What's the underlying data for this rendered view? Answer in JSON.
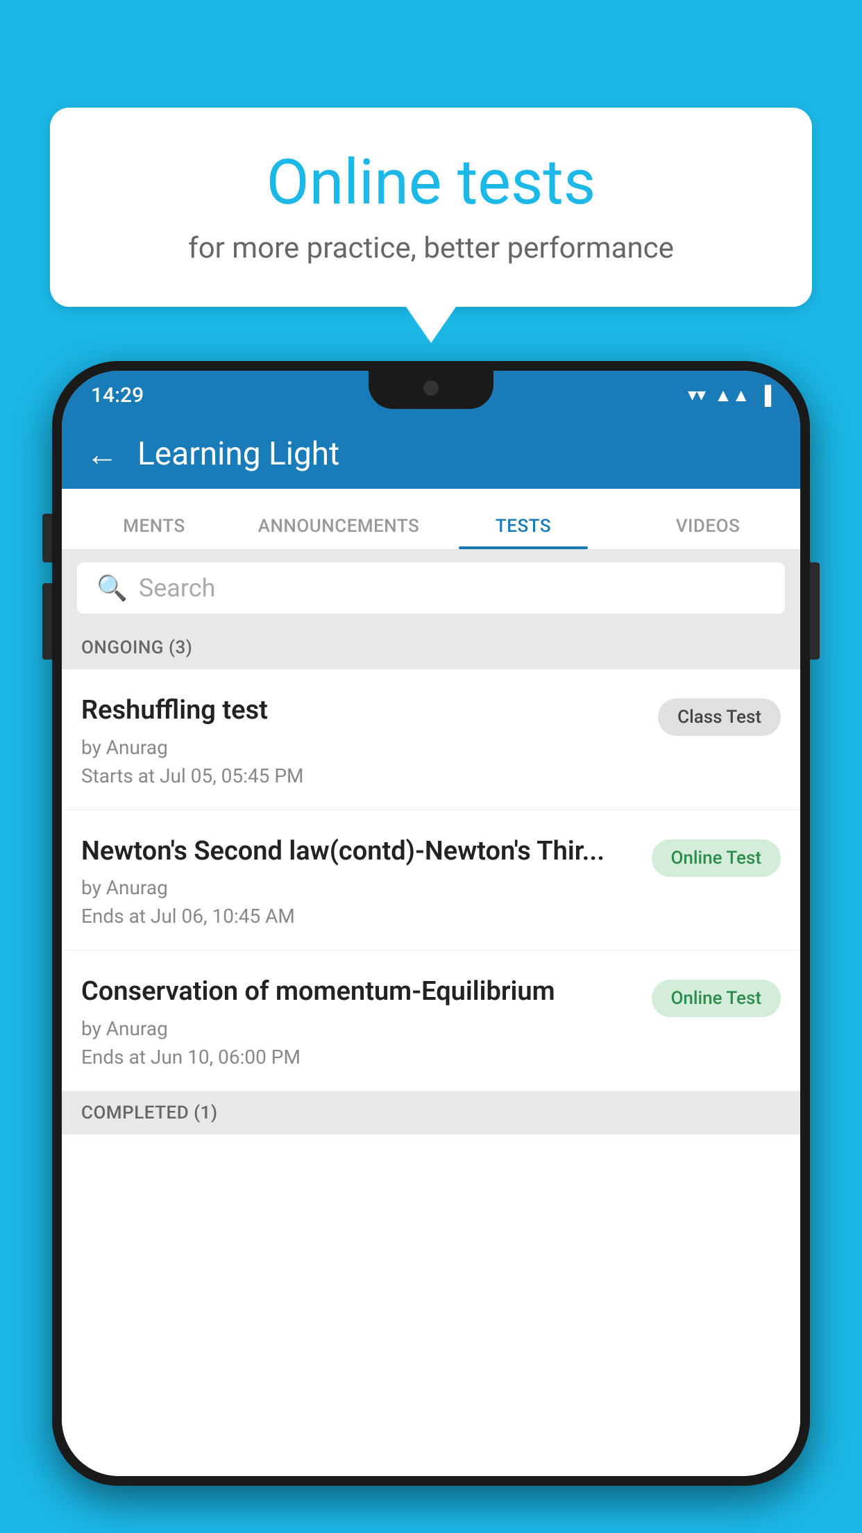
{
  "background": {
    "color": "#1bb8e8"
  },
  "speech_bubble": {
    "title": "Online tests",
    "subtitle": "for more practice, better performance"
  },
  "status_bar": {
    "time": "14:29",
    "wifi": "▼",
    "signal": "▲",
    "battery": "▐"
  },
  "header": {
    "back_label": "←",
    "title": "Learning Light"
  },
  "tabs": [
    {
      "label": "MENTS",
      "active": false
    },
    {
      "label": "ANNOUNCEMENTS",
      "active": false
    },
    {
      "label": "TESTS",
      "active": true
    },
    {
      "label": "VIDEOS",
      "active": false
    }
  ],
  "search": {
    "placeholder": "Search"
  },
  "ongoing_section": {
    "label": "ONGOING (3)"
  },
  "tests": [
    {
      "name": "Reshuffling test",
      "by": "by Anurag",
      "date": "Starts at  Jul 05, 05:45 PM",
      "badge": "Class Test",
      "badge_type": "class"
    },
    {
      "name": "Newton's Second law(contd)-Newton's Thir...",
      "by": "by Anurag",
      "date": "Ends at  Jul 06, 10:45 AM",
      "badge": "Online Test",
      "badge_type": "online"
    },
    {
      "name": "Conservation of momentum-Equilibrium",
      "by": "by Anurag",
      "date": "Ends at  Jun 10, 06:00 PM",
      "badge": "Online Test",
      "badge_type": "online"
    }
  ],
  "completed_section": {
    "label": "COMPLETED (1)"
  }
}
